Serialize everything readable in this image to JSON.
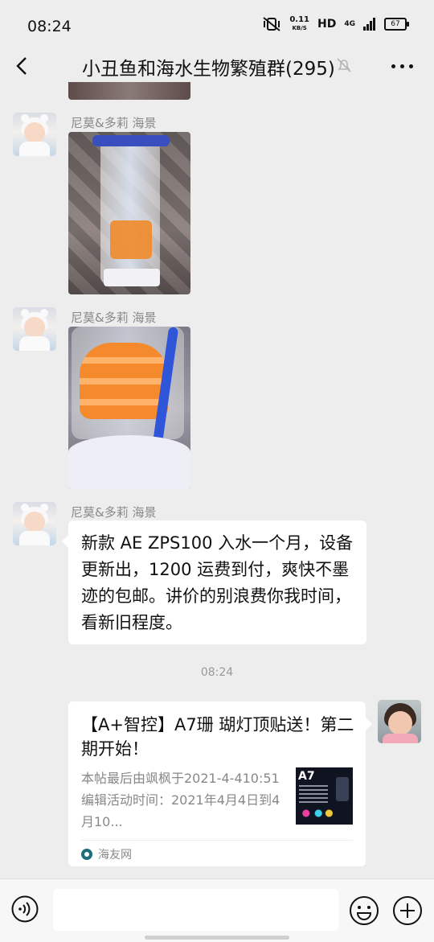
{
  "status_bar": {
    "time": "08:24",
    "speed_value": "0.11",
    "speed_unit": "KB/S",
    "hd": "HD",
    "network": "4G",
    "battery": "67"
  },
  "header": {
    "title": "小丑鱼和海水生物繁殖群(295)"
  },
  "messages": [
    {
      "sender": "尼莫&多莉 海景"
    },
    {
      "sender": "尼莫&多莉 海景"
    },
    {
      "sender": "尼莫&多莉 海景",
      "text": "新款 AE ZPS100 入水一个月，设备更新出，1200 运费到付，爽快不墨迹的包邮。讲价的别浪费你我时间，看新旧程度。"
    }
  ],
  "timestamp": "08:24",
  "link_card": {
    "title": "【A+智控】A7珊 瑚灯顶贴送！第二期开始！",
    "description": "本帖最后由飒枫于2021-4-410:51编辑活动时间：2021年4月4日到4月10...",
    "thumb_label": "A7",
    "source": "海友网"
  },
  "colors": {
    "background": "#ededed",
    "bubble": "#ffffff",
    "brand_source": "#1e6e7c"
  }
}
